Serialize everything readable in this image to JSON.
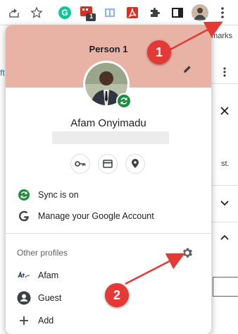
{
  "toolbar": {
    "icons": [
      "share-icon",
      "bookmark-star-icon",
      "grammarly-extension-icon",
      "extension-badge-icon",
      "reading-list-icon",
      "adobe-acrobat-icon",
      "extensions-puzzle-icon",
      "side-panel-icon",
      "profile-avatar-icon",
      "chrome-menu-icon"
    ],
    "extension_badge_count": "1"
  },
  "bookmarks_bar": {
    "text": "marks"
  },
  "background": {
    "left_fragment": "ft",
    "right_fragment": "st."
  },
  "profile_menu": {
    "title": "Person 1",
    "user_name": "Afam Onyimadu",
    "quick_actions": [
      "passwords-key-icon",
      "payment-card-icon",
      "addresses-location-icon"
    ],
    "sync_label": "Sync is on",
    "manage_account_label": "Manage your Google Account",
    "other_profiles_label": "Other profiles",
    "profiles": [
      {
        "label": "Afam",
        "icon": "afam-profile-icon"
      },
      {
        "label": "Guest",
        "icon": "guest-person-icon"
      },
      {
        "label": "Add",
        "icon": "add-plus-icon"
      }
    ]
  },
  "annotations": [
    {
      "label": "1",
      "color": "#e53935"
    },
    {
      "label": "2",
      "color": "#e53935"
    }
  ],
  "colors": {
    "header_bg": "#e8b3a5",
    "sync_green": "#1e8e3e",
    "marker_red": "#e53935"
  }
}
